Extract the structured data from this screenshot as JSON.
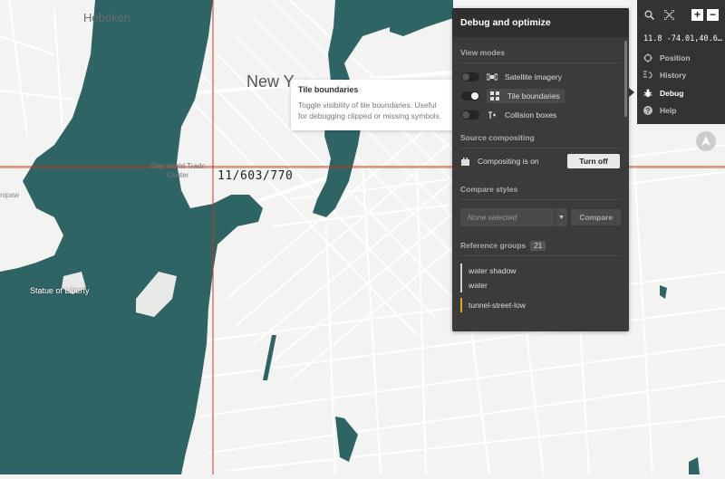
{
  "map": {
    "labels": {
      "hoboken": "Hoboken",
      "new_york": "New Y",
      "wtc": "One World Trade\nCenter",
      "liberty": "Statue of Liberty",
      "nipaw": "nipaw"
    },
    "tile_id": "11/603/770",
    "colors": {
      "water": "#2f6465",
      "land": "#f3f3f1",
      "road": "#ffffff",
      "tile_boundary": "#c0391b"
    }
  },
  "tooltip": {
    "title": "Tile boundaries",
    "body": "Toggle visibility of tile boundaries. Useful for debugging clipped or missing symbols."
  },
  "panel": {
    "title": "Debug and optimize",
    "view_modes_title": "View modes",
    "view_modes": [
      {
        "label": "Satellite imagery",
        "icon": "satellite-icon",
        "on": false
      },
      {
        "label": "Tile boundaries",
        "icon": "tile-grid-icon",
        "on": true
      },
      {
        "label": "Collision boxes",
        "icon": "collision-icon",
        "on": false
      }
    ],
    "source_compositing_title": "Source compositing",
    "compositing_status": "Compositing is on",
    "turn_off_label": "Turn off",
    "compare_styles_title": "Compare styles",
    "compare_select_value": "None selected",
    "compare_button_label": "Compare",
    "reference_groups_title": "Reference groups",
    "reference_groups_count": "21",
    "reference_groups": [
      {
        "items": [
          "water shadow",
          "water"
        ],
        "color": "#cfcfcf"
      },
      {
        "items": [
          "tunnel-street-low"
        ],
        "color": "#e8a21d"
      }
    ]
  },
  "navbar": {
    "coords": "11.8 -74.01,40.6…",
    "zoom_in": "+",
    "zoom_out": "−",
    "items": [
      {
        "label": "Position",
        "icon": "crosshair-icon",
        "active": false
      },
      {
        "label": "History",
        "icon": "history-icon",
        "active": false
      },
      {
        "label": "Debug",
        "icon": "bug-icon",
        "active": true
      },
      {
        "label": "Help",
        "icon": "help-icon",
        "active": false
      }
    ]
  }
}
